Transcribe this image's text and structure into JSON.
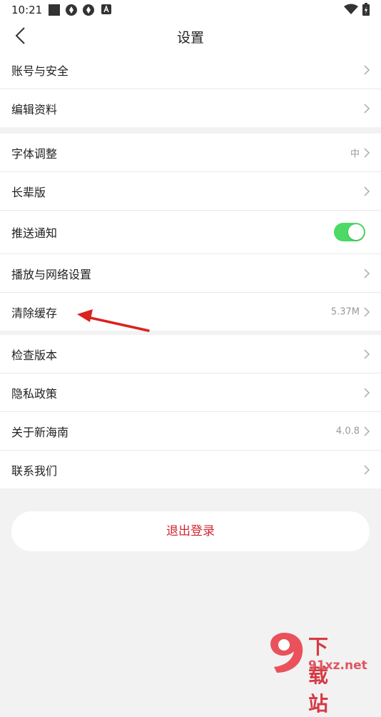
{
  "status_bar": {
    "time": "10:21"
  },
  "header": {
    "title": "设置",
    "back_icon": "chevron-left-icon"
  },
  "groups": [
    {
      "items": [
        {
          "label": "账号与安全",
          "value": "",
          "control": "chevron"
        },
        {
          "label": "编辑资料",
          "value": "",
          "control": "chevron"
        }
      ]
    },
    {
      "items": [
        {
          "label": "字体调整",
          "value": "中",
          "control": "chevron"
        },
        {
          "label": "长辈版",
          "value": "",
          "control": "chevron"
        },
        {
          "label": "推送通知",
          "value": "",
          "control": "toggle",
          "toggle_on": true
        },
        {
          "label": "播放与网络设置",
          "value": "",
          "control": "chevron"
        },
        {
          "label": "清除缓存",
          "value": "5.37M",
          "control": "chevron"
        }
      ]
    },
    {
      "items": [
        {
          "label": "检查版本",
          "value": "",
          "control": "chevron"
        },
        {
          "label": "隐私政策",
          "value": "",
          "control": "chevron"
        },
        {
          "label": "关于新海南",
          "value": "4.0.8",
          "control": "chevron"
        },
        {
          "label": "联系我们",
          "value": "",
          "control": "chevron"
        }
      ]
    }
  ],
  "logout": {
    "label": "退出登录"
  },
  "colors": {
    "accent_red": "#d0272e",
    "toggle_on": "#4cd964",
    "background": "#f2f2f2"
  },
  "watermark": {
    "brand_cn": "下载站",
    "brand_url": "91xz.net"
  }
}
